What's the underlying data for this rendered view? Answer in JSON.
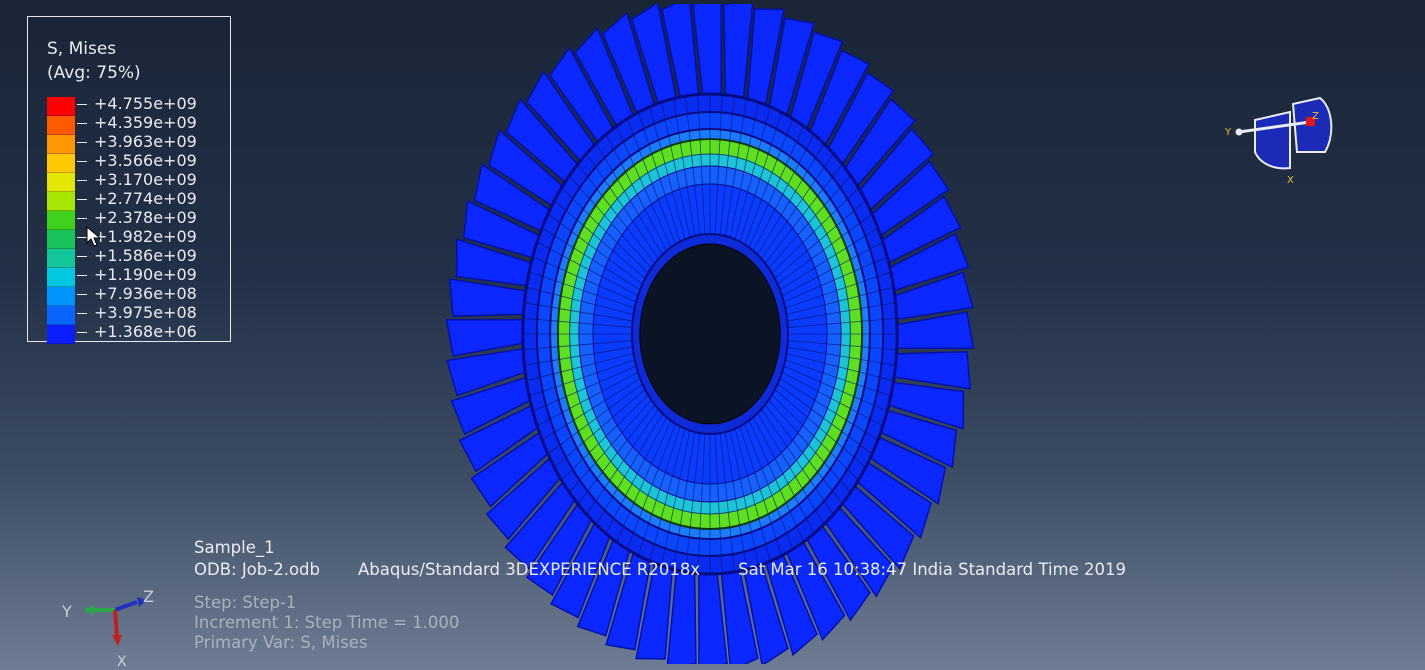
{
  "legend": {
    "title": "S, Mises",
    "subtitle": "(Avg: 75%)",
    "colors": [
      "#ff0000",
      "#ff5a00",
      "#ff9800",
      "#ffc800",
      "#e2e600",
      "#a6e600",
      "#3fd21c",
      "#18c35a",
      "#13c69a",
      "#00c8e0",
      "#0094ff",
      "#0a64ff",
      "#0a1eff"
    ],
    "labels": [
      "+4.755e+09",
      "+4.359e+09",
      "+3.963e+09",
      "+3.566e+09",
      "+3.170e+09",
      "+2.774e+09",
      "+2.378e+09",
      "+1.982e+09",
      "+1.586e+09",
      "+1.190e+09",
      "+7.936e+08",
      "+3.975e+08",
      "+1.368e+06"
    ]
  },
  "info": {
    "model_name": "Sample_1",
    "odb": "ODB: Job-2.odb",
    "solver": "Abaqus/Standard 3DEXPERIENCE R2018x",
    "datetime": "Sat Mar 16 10:38:47 India Standard Time 2019",
    "step": "Step: Step-1",
    "increment": "Increment     1: Step Time =    1.000",
    "primary_var": "Primary Var: S, Mises"
  },
  "triad": {
    "y": "Y",
    "z": "Z",
    "x": "X"
  },
  "view_cube": {
    "y": "Y",
    "z": "Z",
    "x": "X"
  },
  "palette": {
    "blade": "#0a28ff",
    "blade_dark": "#0410a8",
    "hub": "#0a3cff",
    "ring_green": "#5fe01f",
    "ring_cyan": "#1cc4d8"
  }
}
